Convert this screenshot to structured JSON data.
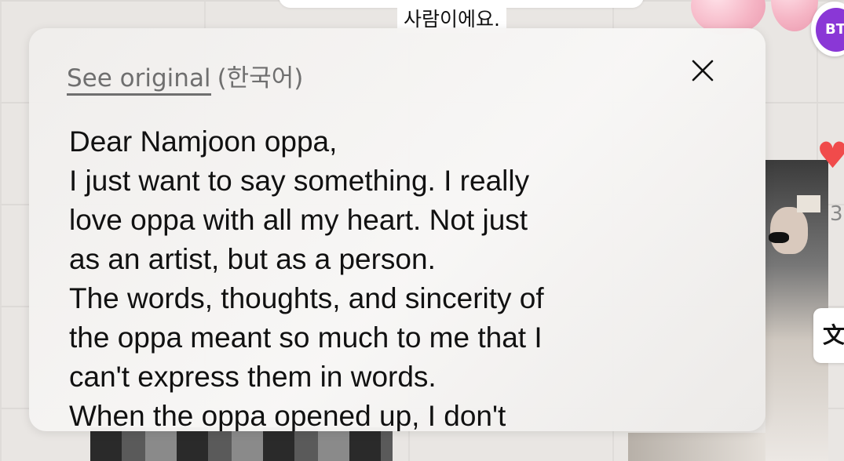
{
  "background": {
    "korean_caption": "사람이에요.",
    "avatar_label": "BT",
    "count_partial": "3",
    "translate_glyph": "文"
  },
  "translation_card": {
    "see_original_label": "See original",
    "language_label": "(한국어)",
    "lines": [
      "Dear Namjoon oppa,",
      "I just want to say something. I really",
      "love oppa with all my heart. Not just",
      "as an artist, but as a person.",
      "The words, thoughts, and sincerity of",
      "the oppa meant so much to me that I",
      "can't express them in words.",
      "When the oppa opened up, I don't"
    ]
  },
  "colors": {
    "accent_avatar": "#8a37d6",
    "heart": "#f04b4b"
  },
  "icons": [
    "close-icon",
    "heart-icon",
    "translate-icon"
  ]
}
